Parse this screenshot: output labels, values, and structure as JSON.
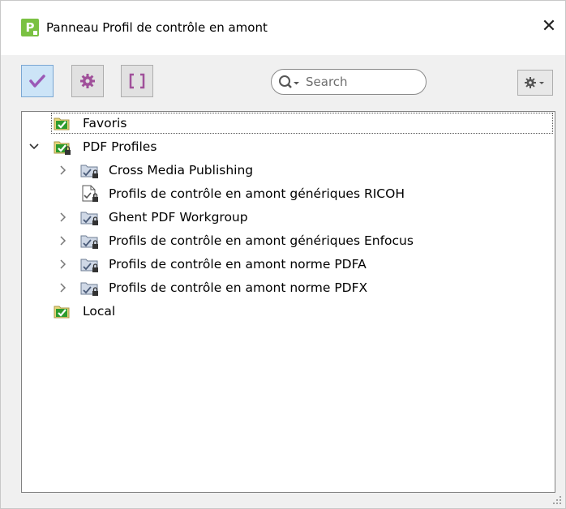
{
  "window": {
    "title": "Panneau Profil de contrôle en amont",
    "icon_letter": "P",
    "close_glyph": "✕"
  },
  "toolbar": {
    "buttons": [
      {
        "name": "profiles-tab",
        "icon": "checkmark-icon",
        "active": true
      },
      {
        "name": "fixups-tab",
        "icon": "gear-icon",
        "active": false
      },
      {
        "name": "brackets-tab",
        "icon": "brackets-icon",
        "active": false
      }
    ],
    "search": {
      "placeholder": "Search",
      "value": ""
    },
    "options_icon": "gear-dropdown-icon"
  },
  "tree": {
    "items": [
      {
        "label": "Favoris",
        "level": 0,
        "expander": "none",
        "icon": "green-check-folder-icon",
        "focused": true
      },
      {
        "label": "PDF Profiles",
        "level": 0,
        "expander": "expanded",
        "icon": "green-check-locked-folder-icon"
      },
      {
        "label": "Cross Media Publishing",
        "level": 1,
        "expander": "collapsed",
        "icon": "locked-profile-folder-icon"
      },
      {
        "label": "Profils de contrôle en amont génériques RICOH",
        "level": 1,
        "expander": "none",
        "icon": "locked-profile-document-icon"
      },
      {
        "label": "Ghent PDF Workgroup",
        "level": 1,
        "expander": "collapsed",
        "icon": "locked-profile-folder-icon"
      },
      {
        "label": "Profils de contrôle en amont génériques Enfocus",
        "level": 1,
        "expander": "collapsed",
        "icon": "locked-profile-folder-icon"
      },
      {
        "label": "Profils de contrôle en amont norme PDFA",
        "level": 1,
        "expander": "collapsed",
        "icon": "locked-profile-folder-icon"
      },
      {
        "label": "Profils de contrôle en amont norme PDFX",
        "level": 1,
        "expander": "collapsed",
        "icon": "locked-profile-folder-icon"
      },
      {
        "label": "Local",
        "level": 0,
        "expander": "none",
        "icon": "green-check-folder-icon"
      }
    ]
  },
  "colors": {
    "accent_green": "#2e9b2e",
    "folder_yellow": "#e8d77a",
    "active_button": "#cce4f7",
    "checkmark_purple": "#9b59b6",
    "gear_purple": "#a0509a"
  }
}
